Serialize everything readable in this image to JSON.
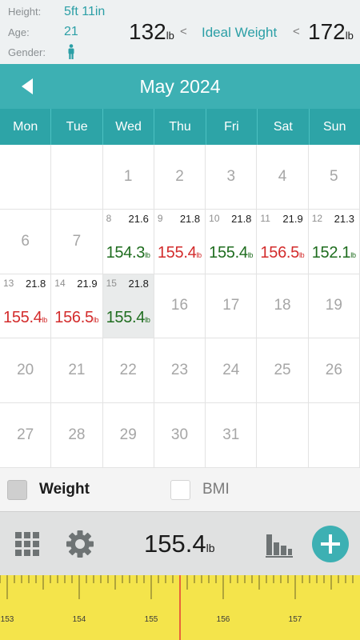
{
  "profile": {
    "height_label": "Height:",
    "height_value": "5ft 11in",
    "age_label": "Age:",
    "age_value": "21",
    "gender_label": "Gender:",
    "gender_icon": "male-person-icon",
    "min_weight": "132",
    "max_weight": "172",
    "unit": "lb",
    "lt_left": "<",
    "lt_right": "<",
    "ideal_label": "Ideal Weight"
  },
  "calendar": {
    "month_title": "May 2024",
    "weekdays": [
      "Mon",
      "Tue",
      "Wed",
      "Thu",
      "Fri",
      "Sat",
      "Sun"
    ],
    "plain_days": [
      "1",
      "2",
      "3",
      "4",
      "5",
      "6",
      "7",
      "16",
      "17",
      "18",
      "19",
      "20",
      "21",
      "22",
      "23",
      "24",
      "25",
      "26",
      "27",
      "28",
      "29",
      "30",
      "31"
    ],
    "entries": [
      {
        "day": "8",
        "bmi": "21.6",
        "weight": "154.3",
        "unit": "lb",
        "status": "green"
      },
      {
        "day": "9",
        "bmi": "21.8",
        "weight": "155.4",
        "unit": "lb",
        "status": "red"
      },
      {
        "day": "10",
        "bmi": "21.8",
        "weight": "155.4",
        "unit": "lb",
        "status": "green"
      },
      {
        "day": "11",
        "bmi": "21.9",
        "weight": "156.5",
        "unit": "lb",
        "status": "red"
      },
      {
        "day": "12",
        "bmi": "21.3",
        "weight": "152.1",
        "unit": "lb",
        "status": "green"
      },
      {
        "day": "13",
        "bmi": "21.8",
        "weight": "155.4",
        "unit": "lb",
        "status": "red"
      },
      {
        "day": "14",
        "bmi": "21.9",
        "weight": "156.5",
        "unit": "lb",
        "status": "red"
      },
      {
        "day": "15",
        "bmi": "21.8",
        "weight": "155.4",
        "unit": "lb",
        "status": "green"
      }
    ],
    "selected_day": "15"
  },
  "legend": {
    "weight_label": "Weight",
    "weight_checked": true,
    "bmi_label": "BMI",
    "bmi_checked": false
  },
  "toolbar": {
    "current_weight": "155.4",
    "unit": "lb",
    "icons": [
      "grid-icon",
      "gear-icon",
      "bar-chart-icon",
      "plus-icon"
    ]
  },
  "ruler": {
    "labels": [
      "153",
      "154",
      "155",
      "156",
      "157"
    ],
    "current_value": 155.4
  },
  "colors": {
    "accent": "#3db0b3",
    "accent_dark": "#2da4a7",
    "teal_text": "#2b9fa6",
    "green": "#1f6d1f",
    "red": "#d32c2c",
    "ruler_bg": "#f4e44b",
    "ruler_needle": "#e53935"
  }
}
